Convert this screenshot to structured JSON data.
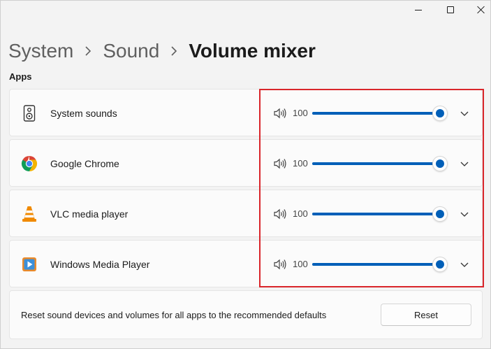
{
  "breadcrumb": {
    "items": [
      "System",
      "Sound"
    ],
    "current": "Volume mixer"
  },
  "section_title": "Apps",
  "apps": [
    {
      "name": "System sounds",
      "icon": "speaker-device-icon",
      "volume": "100",
      "level": 1.0
    },
    {
      "name": "Google Chrome",
      "icon": "chrome-icon",
      "volume": "100",
      "level": 1.0
    },
    {
      "name": "VLC media player",
      "icon": "vlc-cone-icon",
      "volume": "100",
      "level": 1.0
    },
    {
      "name": "Windows Media Player",
      "icon": "windows-media-player-icon",
      "volume": "100",
      "level": 1.0
    }
  ],
  "reset": {
    "text": "Reset sound devices and volumes for all apps to the recommended defaults",
    "button_label": "Reset"
  },
  "colors": {
    "accent": "#005fb8",
    "highlight": "#d9252a",
    "background": "#f3f3f3",
    "card": "#fbfbfb"
  }
}
